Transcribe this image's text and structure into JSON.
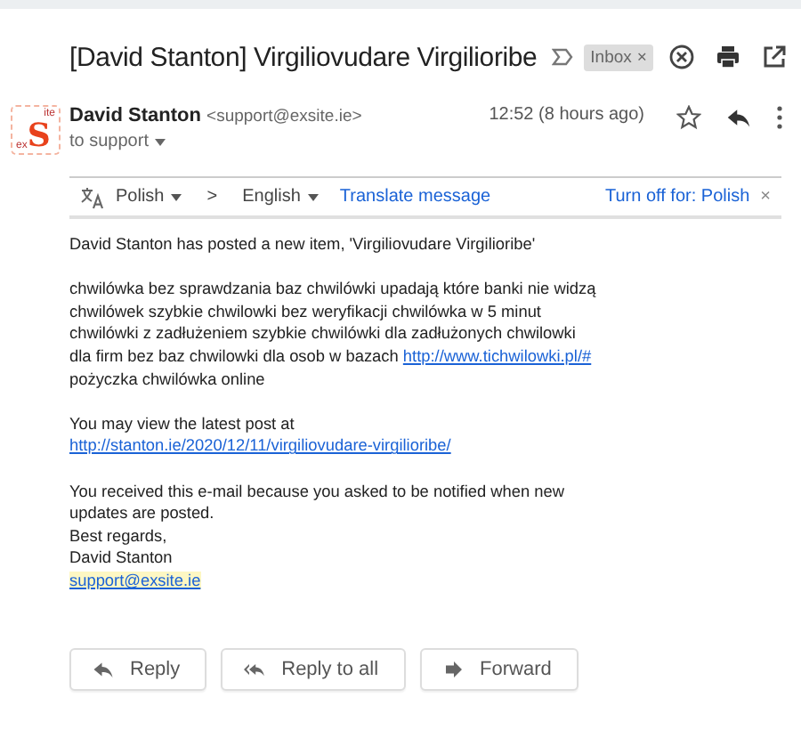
{
  "subject": {
    "title": "[David Stanton] Virgiliovudare Virgilioribe",
    "label": "Inbox",
    "label_close": "×"
  },
  "sender": {
    "logo_texts": [
      "ite",
      "ex",
      "S"
    ],
    "name": "David Stanton",
    "email": "<support@exsite.ie>",
    "to": "to support",
    "time": "12:52 (8 hours ago)"
  },
  "translate_bar": {
    "from": "Polish",
    "separator": ">",
    "to": "English",
    "action": "Translate message",
    "turn_off": "Turn off for: Polish",
    "close": "×"
  },
  "body": {
    "intro": "David Stanton has posted a new item, 'Virgiliovudare Virgilioribe'",
    "paragraph_before": "chwilówka bez sprawdzania baz chwilówki upadają które banki nie widzą chwilówek szybkie chwilowki bez weryfikacji chwilówka w 5 minut chwilówki z zadłużeniem szybkie chwilówki dla zadłużonych chwilowki dla firm bez baz chwilowki dla osob w bazach",
    "paragraph_link": "http://www.tichwilowki.pl/#",
    "paragraph_after": "pożyczka chwilówka online",
    "view_text": "You may view the latest post at",
    "view_link": "http://stanton.ie/2020/12/11/virgiliovudare-virgilioribe/",
    "notice": "You received this e-mail because you asked to be notified when new updates are posted.",
    "closing": [
      "Best regards,",
      "David Stanton"
    ],
    "signature_link": "support@exsite.ie"
  },
  "actions": [
    {
      "kind": "reply",
      "label": "Reply"
    },
    {
      "kind": "reply_all",
      "label": "Reply to all"
    },
    {
      "kind": "forward",
      "label": "Forward"
    }
  ]
}
